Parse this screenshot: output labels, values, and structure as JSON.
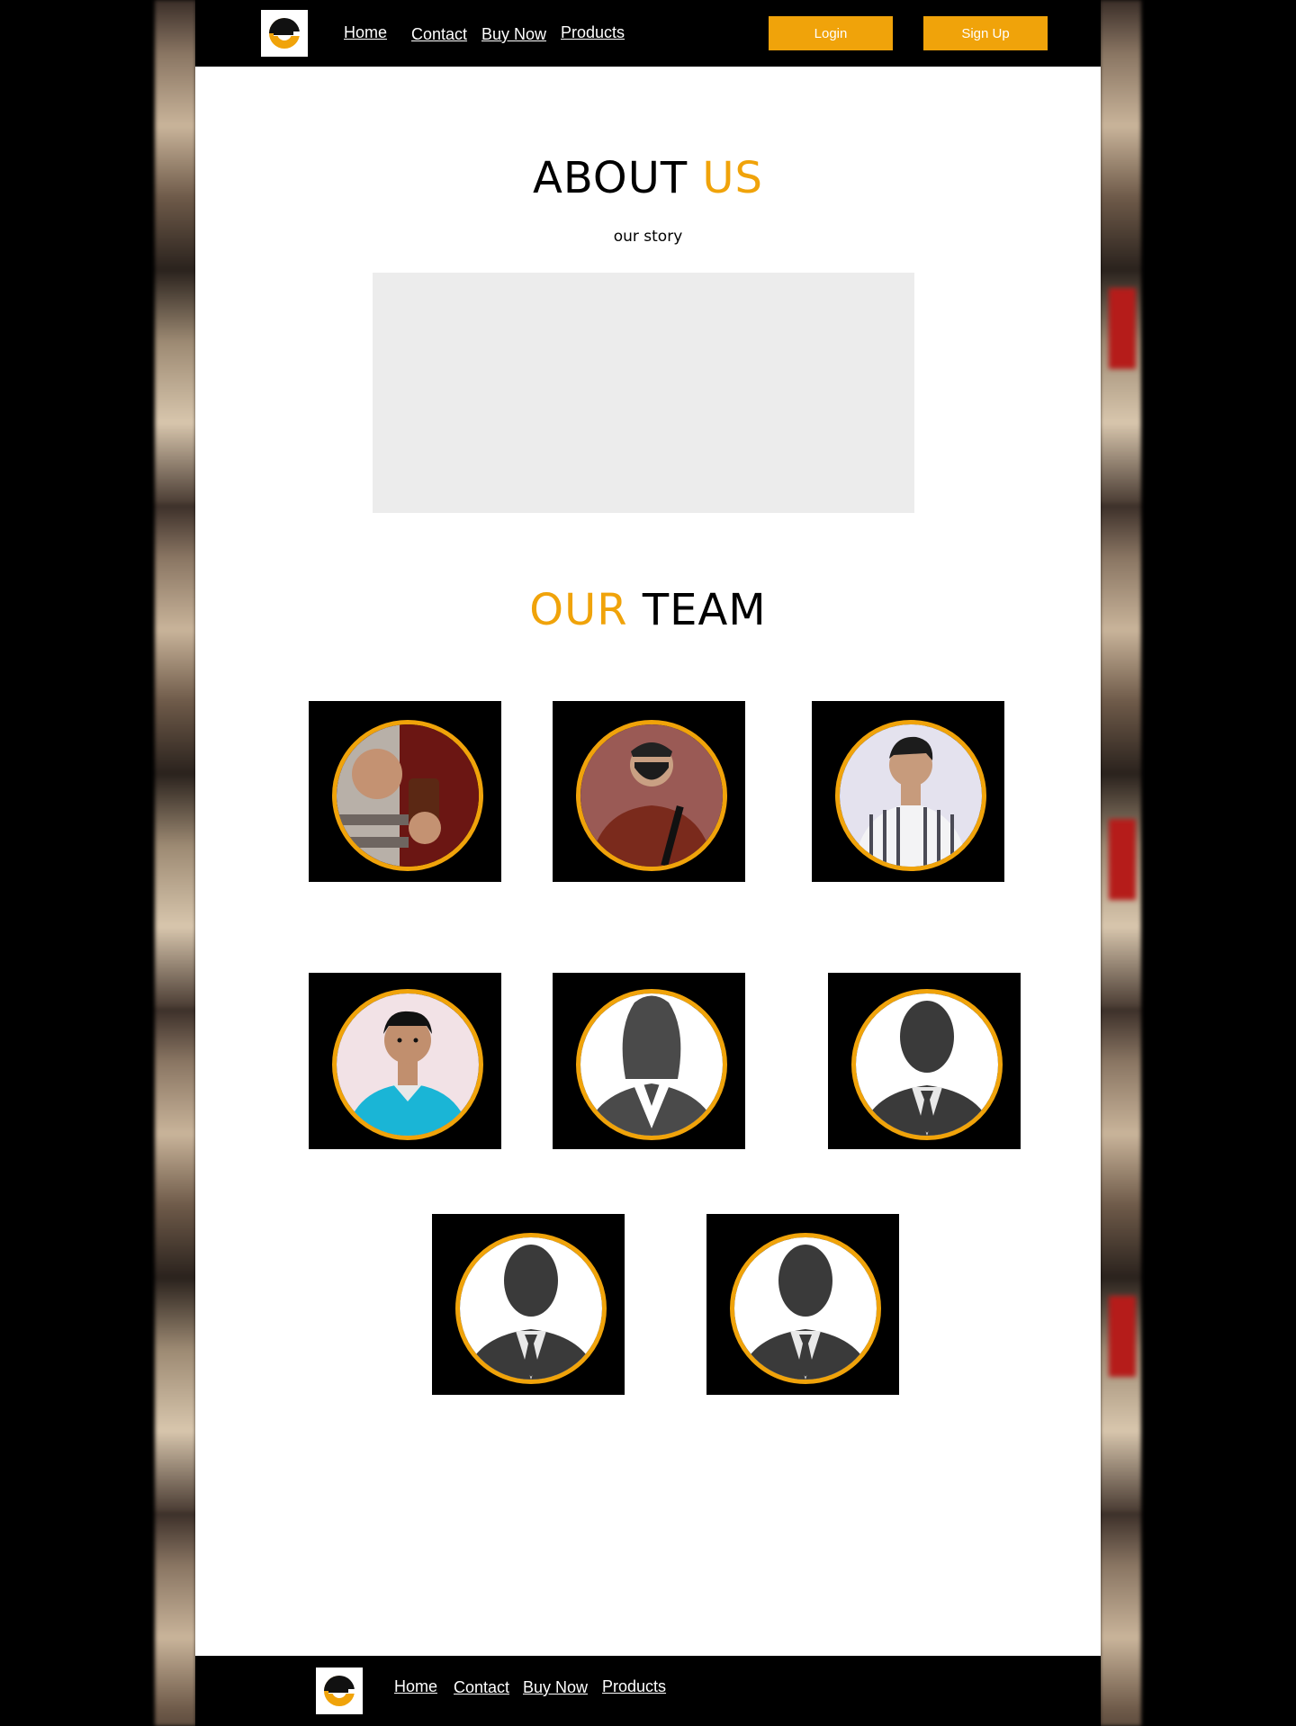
{
  "nav": {
    "links": [
      "Home",
      "Contact",
      "Buy Now",
      "Products"
    ],
    "login_label": "Login",
    "signup_label": "Sign Up"
  },
  "about": {
    "title_main": "ABOUT",
    "title_accent": "US",
    "subtitle": "our story"
  },
  "team": {
    "title_accent": "OUR",
    "title_main": "TEAM",
    "members": [
      {
        "avatar": "photo-person-drinking"
      },
      {
        "avatar": "photo-person-mask"
      },
      {
        "avatar": "photo-person-striped-shirt"
      },
      {
        "avatar": "photo-person-blue-shirt"
      },
      {
        "avatar": "placeholder-female-silhouette"
      },
      {
        "avatar": "placeholder-male-silhouette"
      },
      {
        "avatar": "placeholder-male-silhouette"
      },
      {
        "avatar": "placeholder-male-silhouette"
      }
    ]
  },
  "footer": {
    "links": [
      "Home",
      "Contact",
      "Buy Now",
      "Products"
    ]
  },
  "colors": {
    "accent": "#f0a30a",
    "nav_bg": "#000000",
    "story_box": "#ececec"
  }
}
